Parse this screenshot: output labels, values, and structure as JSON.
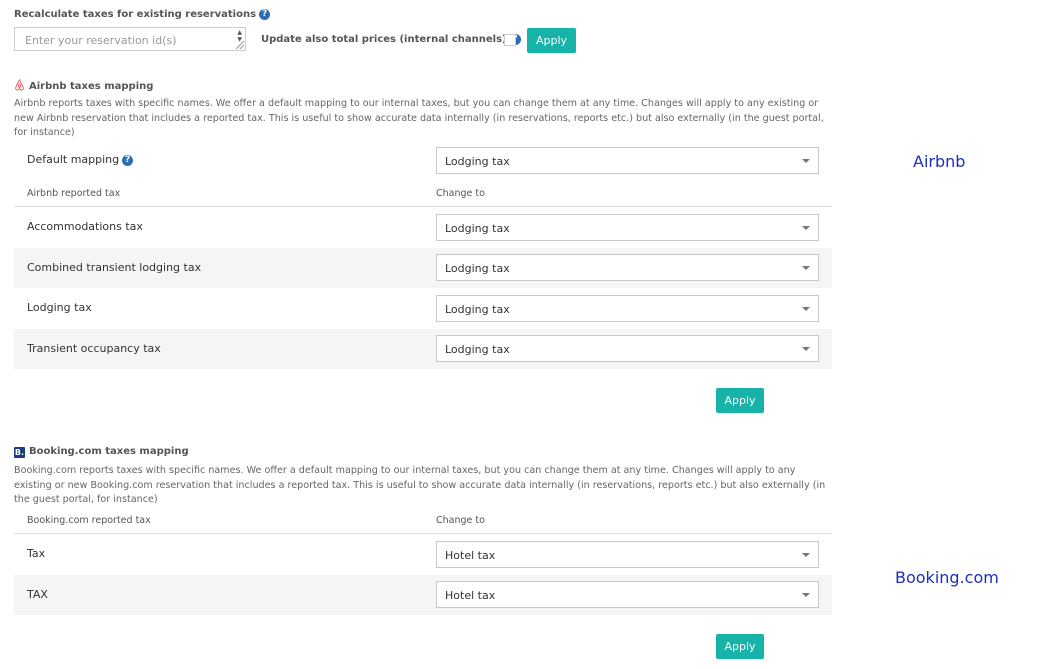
{
  "recalculate": {
    "title": "Recalculate taxes for existing reservations",
    "help_icon": "question-circle-icon",
    "input_placeholder": "Enter your reservation id(s)",
    "update_label": "Update also total prices (internal channels)",
    "update_checked": false,
    "apply_label": "Apply"
  },
  "airbnb": {
    "icon": "airbnb-logo-icon",
    "title": "Airbnb taxes mapping",
    "description_lines": [
      "Airbnb reports taxes with specific names. We offer a default mapping to our internal taxes, but you can change them at any time. Changes will apply to any existing or",
      "new Airbnb reservation that includes a reported tax. This is useful to show accurate data internally (in reservations, reports etc.) but also externally (in the guest portal,",
      "for instance)"
    ],
    "default_mapping_label": "Default mapping",
    "default_mapping_value": "Lodging tax",
    "col_reported": "Airbnb reported tax",
    "col_change": "Change to",
    "rows": [
      {
        "name": "Accommodations tax",
        "value": "Lodging tax"
      },
      {
        "name": "Combined transient lodging tax",
        "value": "Lodging tax"
      },
      {
        "name": "Lodging tax",
        "value": "Lodging tax"
      },
      {
        "name": "Transient occupancy tax",
        "value": "Lodging tax"
      }
    ],
    "apply_label": "Apply",
    "side_label": "Airbnb"
  },
  "booking": {
    "icon": "booking-logo-icon",
    "icon_letter": "B.",
    "title": "Booking.com taxes mapping",
    "description_lines": [
      "Booking.com reports taxes with specific names. We offer a default mapping to our internal taxes, but you can change them at any time. Changes will apply to any",
      "existing or new Booking.com reservation that includes a reported tax. This is useful to show accurate data internally (in reservations, reports etc.) but also externally (in",
      "the guest portal, for instance)"
    ],
    "col_reported": "Booking.com reported tax",
    "col_change": "Change to",
    "rows": [
      {
        "name": "Tax",
        "value": "Hotel tax"
      },
      {
        "name": "TAX",
        "value": "Hotel tax"
      }
    ],
    "apply_label": "Apply",
    "side_label": "Booking.com"
  }
}
